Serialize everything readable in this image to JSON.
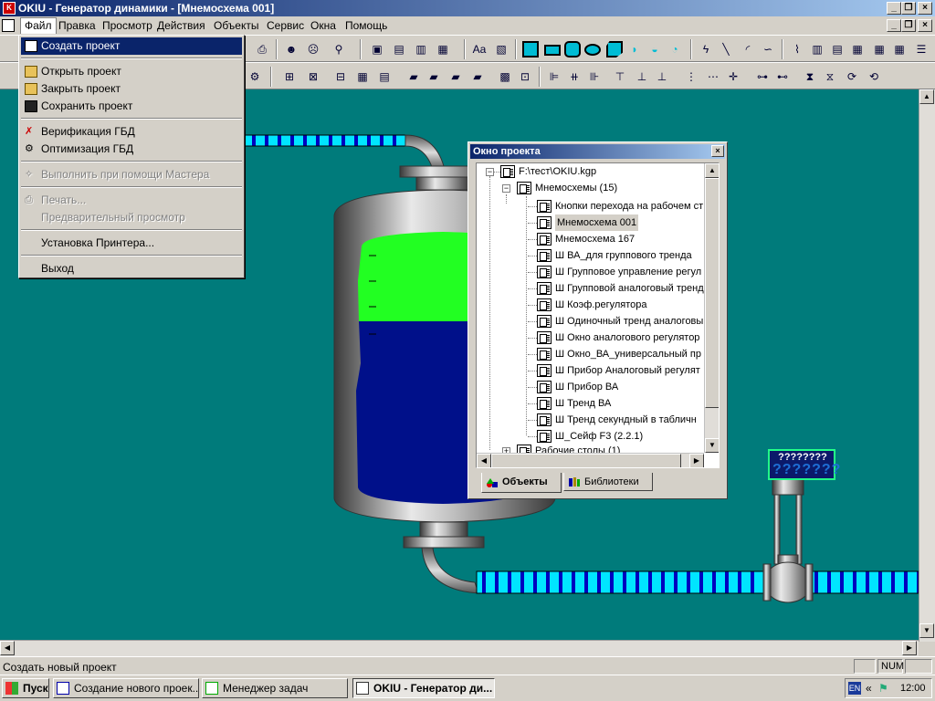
{
  "window": {
    "title": "OKIU - Генератор динамики - [Мнемосхема 001]"
  },
  "menubar": {
    "items": [
      "Файл",
      "Правка",
      "Просмотр",
      "Действия",
      "Объекты",
      "Сервис",
      "Окна",
      "Помощь"
    ],
    "active": "Файл"
  },
  "file_menu": {
    "items": [
      {
        "label": "Создать проект",
        "state": "selected",
        "icon": "new-project-icon"
      },
      {
        "label": "Открыть проект",
        "state": "enabled",
        "icon": "open-folder-icon"
      },
      {
        "label": "Закрыть проект",
        "state": "enabled",
        "icon": "close-project-icon"
      },
      {
        "label": "Сохранить проект",
        "state": "enabled",
        "icon": "save-disk-icon"
      },
      {
        "label": "Верификация ГБД",
        "state": "enabled",
        "icon": "verify-icon"
      },
      {
        "label": "Оптимизация ГБД",
        "state": "enabled",
        "icon": "optimize-icon"
      },
      {
        "label": "Выполнить при помощи Мастера",
        "state": "disabled",
        "icon": "wizard-icon"
      },
      {
        "label": "Печать...",
        "state": "disabled",
        "icon": "printer-icon"
      },
      {
        "label": "Предварительный просмотр",
        "state": "disabled",
        "icon": ""
      },
      {
        "label": "Установка Принтера...",
        "state": "enabled",
        "icon": ""
      },
      {
        "label": "Выход",
        "state": "enabled",
        "icon": ""
      }
    ]
  },
  "canvas": {
    "indicator_text_top": "????????",
    "indicator_text_bottom": "???????",
    "background_color": "#007b7b",
    "liquid_top_color": "#22ff22",
    "liquid_bottom_color": "#00108a"
  },
  "project_window": {
    "title": "Окно проекта",
    "root": "F:\\тест\\OKIU.kgp",
    "group": "Мнемосхемы (15)",
    "items": [
      "Кнопки перехода на рабочем ст",
      "Мнемосхема 001",
      "Мнемосхема 167",
      "Ш ВА_для группового тренда",
      "Ш Групповое управление регул",
      "Ш Групповой аналоговый тренд",
      "Ш Коэф.регулятора",
      "Ш Одиночный тренд аналоговы",
      "Ш Окно аналогового регулятор",
      "Ш Окно_ВА_универсальный пр",
      "Ш Прибор Аналоговый регулят",
      "Ш Прибор ВА",
      "Ш Тренд ВА",
      "Ш Тренд секундный в табличн",
      "Ш_Сейф F3 (2.2.1)"
    ],
    "selected_item": "Мнемосхема 001",
    "group2": "Рабочие столы (1)",
    "tabs": [
      "Объекты",
      "Библиотеки"
    ],
    "active_tab": "Объекты"
  },
  "statusbar": {
    "text": "Создать новый проект",
    "num": "NUM"
  },
  "taskbar": {
    "start": "Пуск",
    "buttons": [
      {
        "label": "Создание нового проек...",
        "pressed": false
      },
      {
        "label": "Менеджер задач",
        "pressed": false
      },
      {
        "label": "OKIU - Генератор ди...",
        "pressed": true
      }
    ],
    "lang": "EN",
    "clock": "12:00"
  }
}
